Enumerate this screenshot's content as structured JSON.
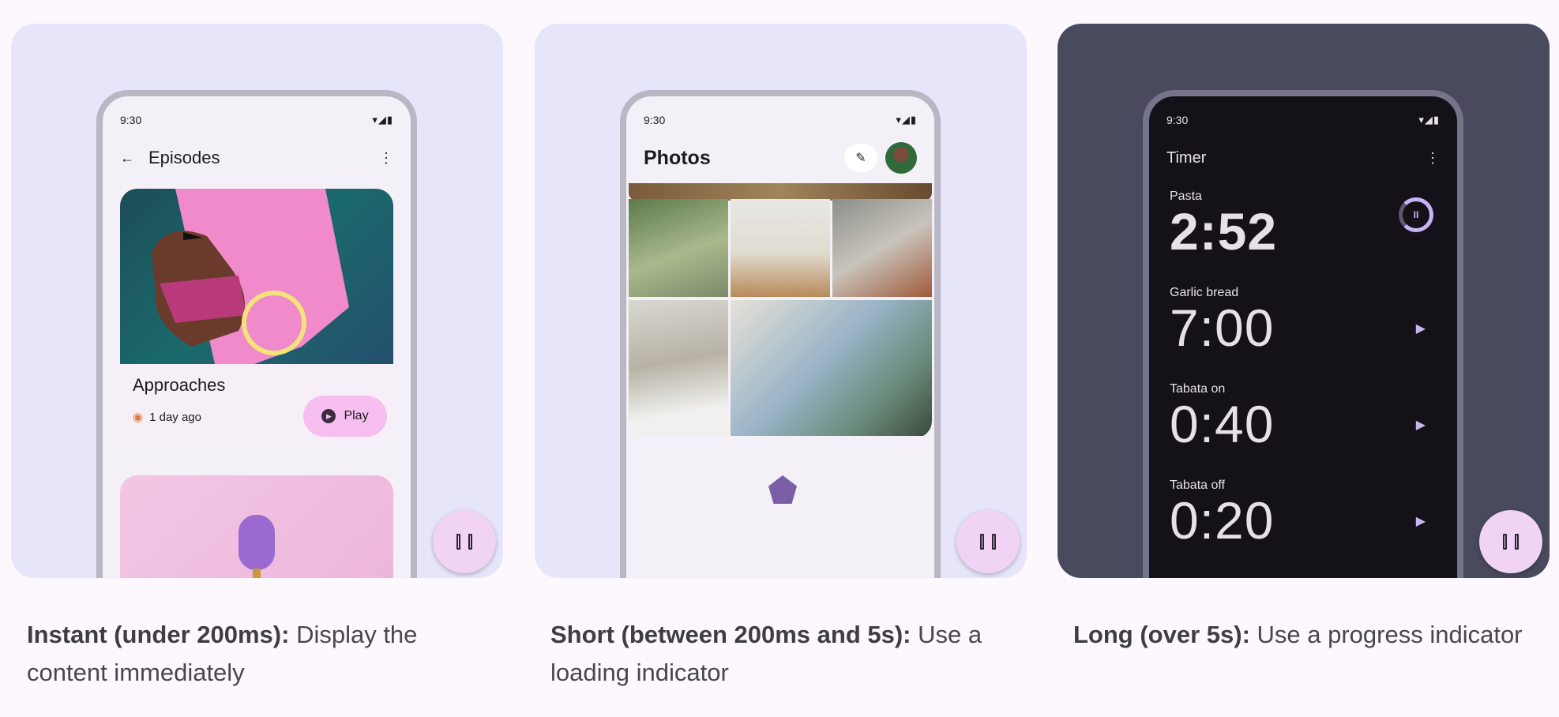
{
  "panels": {
    "instant": {
      "caption_bold": "Instant (under 200ms):",
      "caption_text": " Display the content immediately",
      "status_time": "9:30",
      "app_title": "Episodes",
      "episode_title": "Approaches",
      "episode_meta": "1 day ago",
      "play_label": "Play"
    },
    "short": {
      "caption_bold": "Short (between 200ms and 5s):",
      "caption_text": " Use a loading indicator",
      "status_time": "9:30",
      "app_title": "Photos"
    },
    "long": {
      "caption_bold": "Long (over 5s):",
      "caption_text": " Use a progress indicator",
      "status_time": "9:30",
      "app_title": "Timer",
      "timers": [
        {
          "label": "Pasta",
          "value": "2:52"
        },
        {
          "label": "Garlic bread",
          "value": "7:00"
        },
        {
          "label": "Tabata on",
          "value": "0:40"
        },
        {
          "label": "Tabata off",
          "value": "0:20"
        }
      ]
    }
  },
  "icons": {
    "back": "arrow-back-icon",
    "more": "more-vert-icon",
    "pause": "pause-icon",
    "play": "play-icon",
    "podcast": "podcast-icon",
    "edit": "edit-icon",
    "loading": "loading-indicator"
  },
  "colors": {
    "card_light": "#e7e5f9",
    "card_dark": "#4a4a5e",
    "fab": "#f1d3f6",
    "play_button": "#f6bff0",
    "accent": "#c7b3f5"
  }
}
